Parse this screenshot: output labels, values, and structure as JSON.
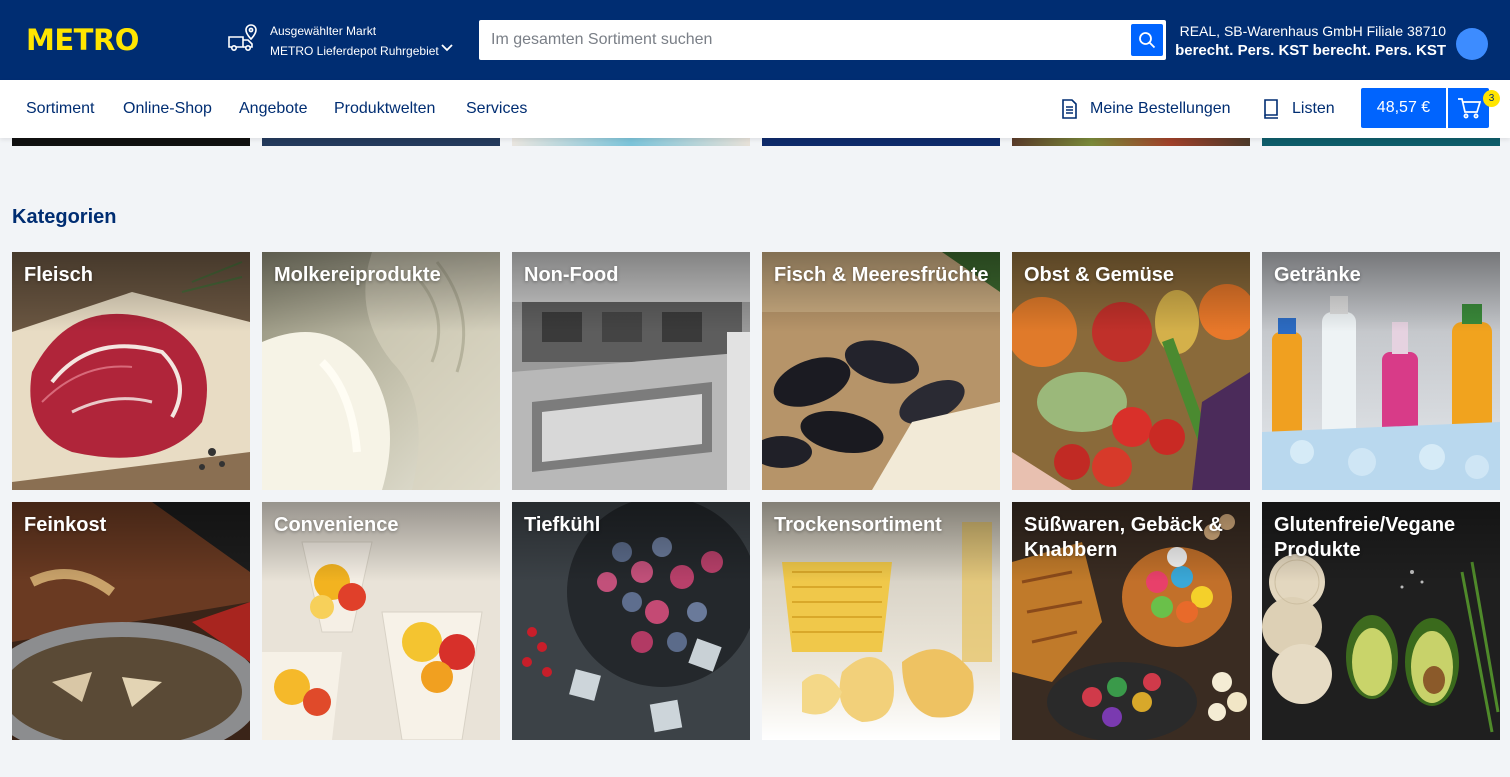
{
  "brand": {
    "logo_text": "METRO"
  },
  "store": {
    "caption": "Ausgewählter Markt",
    "name": "METRO Lieferdepot Ruhrgebiet"
  },
  "search": {
    "placeholder": "Im gesamten Sortiment suchen",
    "value": ""
  },
  "account": {
    "company": "REAL, SB-Warenhaus GmbH Filiale 38710",
    "user": "berecht. Pers. KST berecht. Pers. KST"
  },
  "nav": {
    "items": [
      "Sortiment",
      "Online-Shop",
      "Angebote",
      "Produktwelten",
      "Services"
    ],
    "orders_label": "Meine Bestellungen",
    "lists_label": "Listen",
    "cart_total": "48,57 €",
    "cart_count": "3"
  },
  "categories": {
    "title": "Kategorien",
    "items": [
      "Fleisch",
      "Molkereiprodukte",
      "Non-Food",
      "Fisch & Meeresfrüchte",
      "Obst & Gemüse",
      "Getränke",
      "Feinkost",
      "Convenience",
      "Tiefkühl",
      "Trockensortiment",
      "Süßwaren, Gebäck & Knabbern",
      "Glutenfreie/Vegane Produkte"
    ]
  },
  "colors": {
    "header": "#002d72",
    "accent": "#0064fe",
    "logo": "#ffe500",
    "background": "#f2f4f7"
  },
  "icons": [
    "truck-location-icon",
    "chevron-down-icon",
    "search-icon",
    "orders-icon",
    "list-icon",
    "cart-icon"
  ]
}
